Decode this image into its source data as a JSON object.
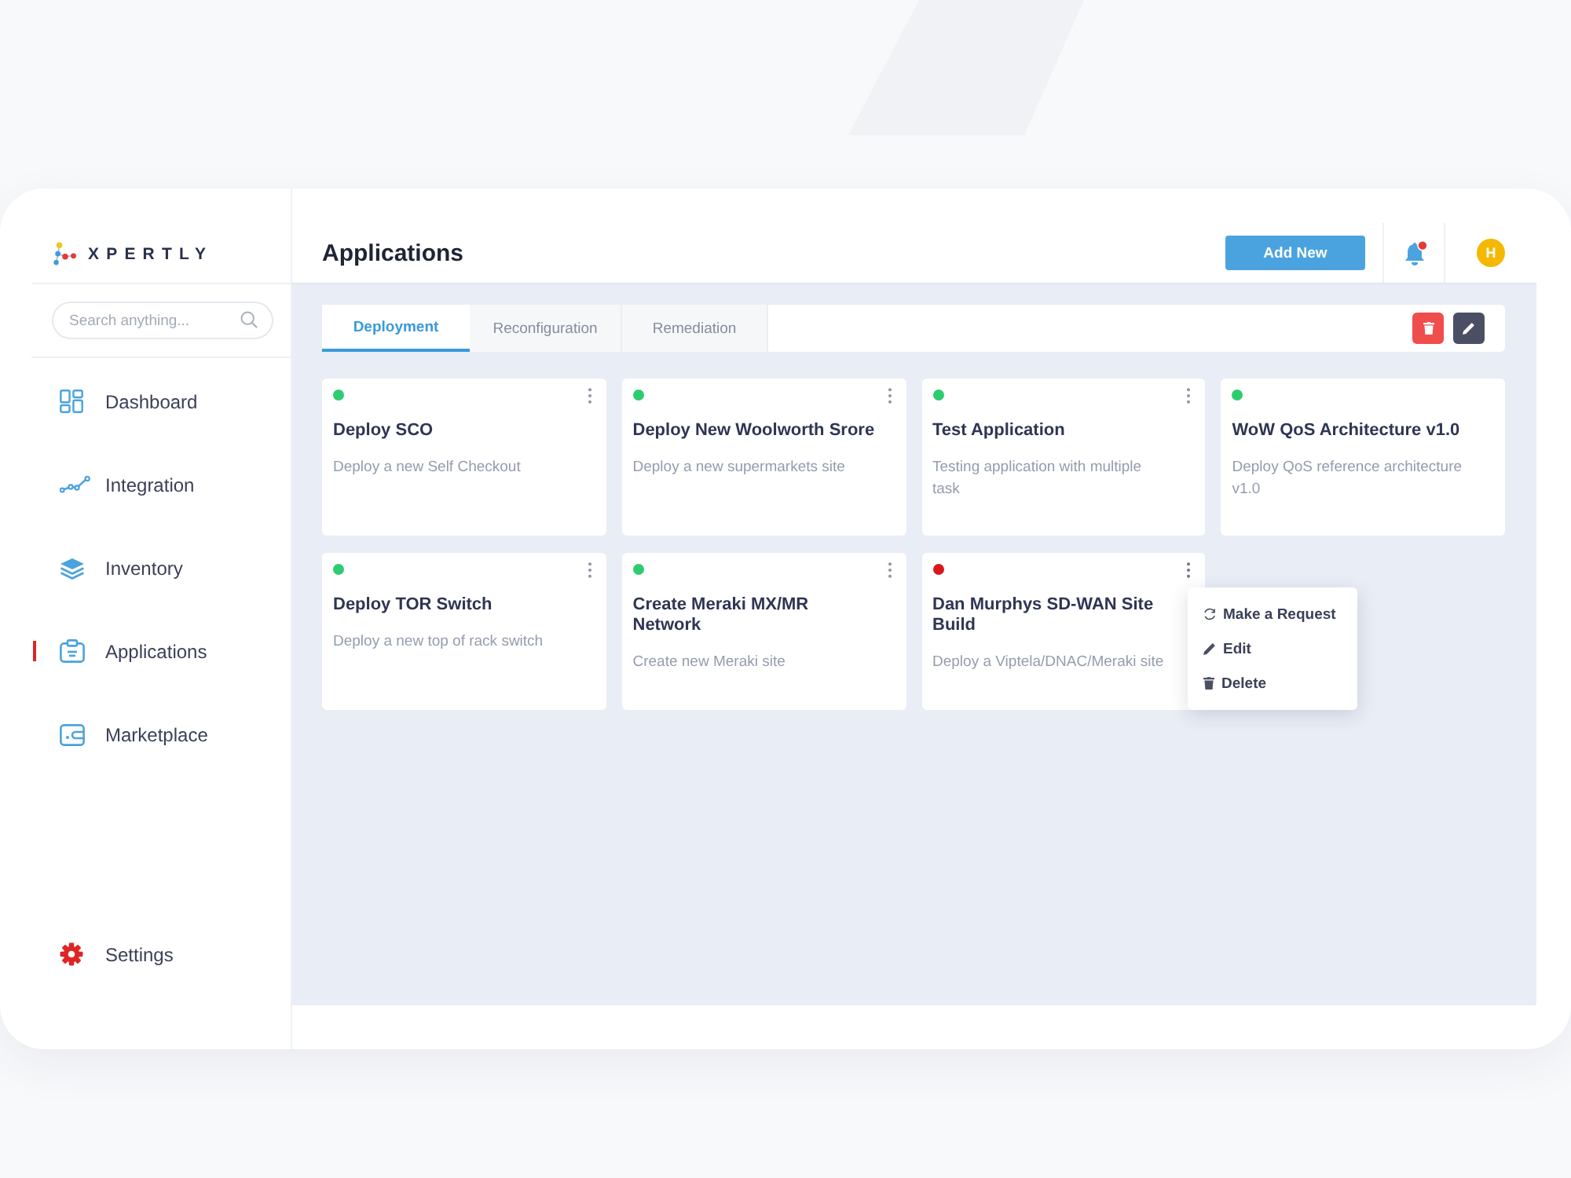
{
  "sidebar": {
    "logo": {
      "text": "XPERTLY"
    },
    "search": {
      "placeholder": "Search anything..."
    },
    "nav": [
      {
        "label": "Dashboard",
        "selected": false
      },
      {
        "label": "Integration",
        "selected": false
      },
      {
        "label": "Inventory",
        "selected": false
      },
      {
        "label": "Applications",
        "selected": true
      },
      {
        "label": "Marketplace",
        "selected": false
      }
    ],
    "footer_item": {
      "label": "Settings"
    }
  },
  "header": {
    "title": "Applications",
    "add_button": "Add New",
    "notifications": {
      "unread": true
    },
    "avatar": {
      "initial": "H"
    }
  },
  "tabs": [
    {
      "label": "Deployment",
      "selected": true
    },
    {
      "label": "Reconfiguration",
      "selected": false
    },
    {
      "label": "Remediation",
      "selected": false
    }
  ],
  "cards": [
    {
      "title": "Deploy SCO",
      "description": "Deploy a new Self Checkout",
      "color": "#2ecc71",
      "has_menu": true,
      "menu_open": false
    },
    {
      "title": "Deploy New Woolworth Srore",
      "description": "Deploy a new supermarkets site",
      "color": "#2ecc71",
      "has_menu": true,
      "menu_open": false
    },
    {
      "title": "Test Application",
      "description": "Testing application with multiple task",
      "color": "#2ecc71",
      "has_menu": true,
      "menu_open": false
    },
    {
      "title": "WoW QoS Architecture v1.0",
      "description": "Deploy QoS reference architecture v1.0",
      "color": "#2ecc71",
      "has_menu": false,
      "menu_open": false
    },
    {
      "title": "Deploy TOR Switch",
      "description": "Deploy a new top of rack switch",
      "color": "#2ecc71",
      "has_menu": true,
      "menu_open": false
    },
    {
      "title": "Create Meraki MX/MR Network",
      "description": "Create new Meraki site",
      "color": "#2ecc71",
      "has_menu": true,
      "menu_open": false
    },
    {
      "title": "Dan Murphys SD-WAN Site Build",
      "description": "Deploy a Viptela/DNAC/Meraki site",
      "color": "#d7191f",
      "has_menu": true,
      "menu_open": true
    }
  ],
  "context_menu": {
    "items": [
      {
        "label": "Make a Request",
        "kind": "request"
      },
      {
        "label": "Edit",
        "kind": "edit"
      },
      {
        "label": "Delete",
        "kind": "delete"
      }
    ]
  }
}
